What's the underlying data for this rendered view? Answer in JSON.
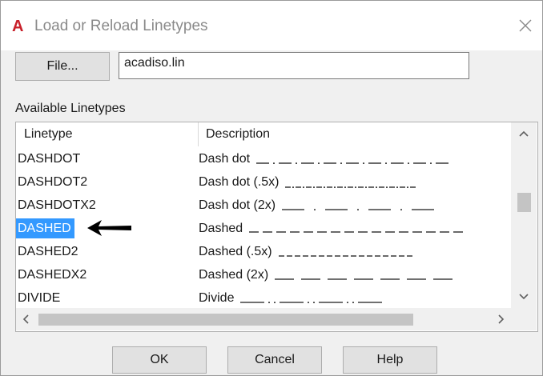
{
  "window": {
    "title": "Load or Reload Linetypes",
    "logo_letter": "A",
    "close_glyph": "×"
  },
  "file": {
    "button_label": "File...",
    "value": "acadiso.lin"
  },
  "available_label": "Available Linetypes",
  "list": {
    "columns": [
      "Linetype",
      "Description"
    ],
    "rows": [
      {
        "name": "DASHDOT",
        "description": "Dash dot",
        "pattern": "dashdot"
      },
      {
        "name": "DASHDOT2",
        "description": "Dash dot (.5x)",
        "pattern": "dashdot2"
      },
      {
        "name": "DASHDOTX2",
        "description": "Dash dot (2x)",
        "pattern": "dashdotx2"
      },
      {
        "name": "DASHED",
        "description": "Dashed",
        "pattern": "dashed",
        "selected": true
      },
      {
        "name": "DASHED2",
        "description": "Dashed (.5x)",
        "pattern": "dashed2"
      },
      {
        "name": "DASHEDX2",
        "description": "Dashed (2x)",
        "pattern": "dashedx2"
      },
      {
        "name": "DIVIDE",
        "description": "Divide",
        "pattern": "divide"
      }
    ]
  },
  "buttons": {
    "ok": "OK",
    "cancel": "Cancel",
    "help": "Help"
  },
  "colors": {
    "selection": "#3399ff",
    "logo": "#c8202a",
    "dialog_bg": "#f0f0f0"
  },
  "icons": {
    "close": "close-icon",
    "scroll_up": "chevron-up-icon",
    "scroll_down": "chevron-down-icon",
    "scroll_left": "chevron-left-icon",
    "scroll_right": "chevron-right-icon",
    "annotation": "arrow-left-icon"
  }
}
